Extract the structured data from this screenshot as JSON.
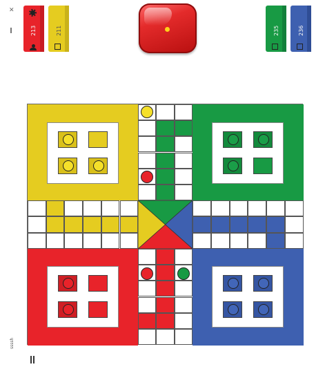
{
  "players": [
    {
      "color": "#e8232a",
      "count": "213",
      "icons": [
        "gear-icon",
        "person-icon"
      ]
    },
    {
      "color": "#e5cc20",
      "count": "211",
      "icons": [
        "square-icon"
      ]
    },
    {
      "color": "#189a44",
      "count": "235",
      "icons": [
        "square-icon"
      ]
    },
    {
      "color": "#3e60b0",
      "count": "236",
      "icons": [
        "square-icon"
      ]
    }
  ],
  "dice": {
    "value": 1,
    "color": "#e42b2b",
    "pip_color": "#ffd21a"
  },
  "window": {
    "icon": "close-icon",
    "menu": "menu-icon"
  },
  "footer": {
    "left_text": "ssssh",
    "bar_icon": "pause-icon"
  },
  "colors": {
    "red": "#e8232a",
    "yellow": "#e5cc20",
    "green": "#189a44",
    "blue": "#3e60b0"
  }
}
